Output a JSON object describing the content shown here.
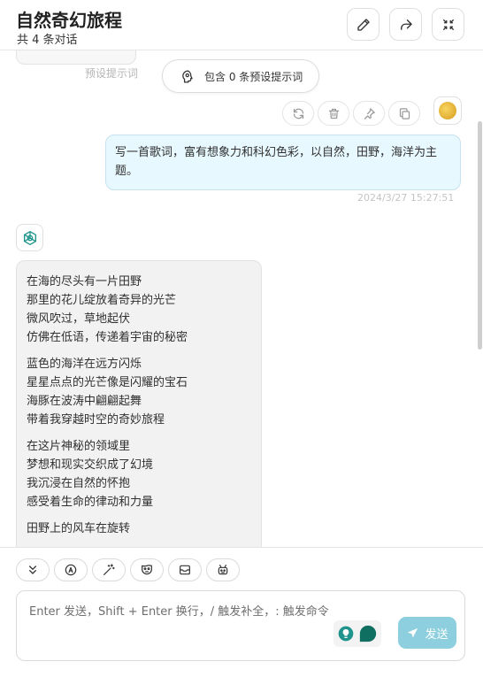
{
  "header": {
    "title": "自然奇幻旅程",
    "subtitle": "共 4 条对话",
    "buttons": [
      "edit-icon",
      "share-icon",
      "collapse-icon"
    ]
  },
  "chat": {
    "ghost_label": "预设提示词",
    "prompt_pill": "包含 0 条预设提示词",
    "message_actions": [
      "refresh-icon",
      "delete-icon",
      "pin-icon",
      "copy-icon"
    ],
    "user_message": {
      "text": "写一首歌词，富有想象力和科幻色彩，以自然，田野，海洋为主题。",
      "time": "2024/3/27 15:27:51"
    },
    "bot_message": {
      "stanzas": [
        [
          "在海的尽头有一片田野",
          "那里的花儿绽放着奇异的光芒",
          "微风吹过，草地起伏",
          "仿佛在低语，传递着宇宙的秘密"
        ],
        [
          "蓝色的海洋在远方闪烁",
          "星星点点的光芒像是闪耀的宝石",
          "海豚在波涛中翩翩起舞",
          "带着我穿越时空的奇妙旅程"
        ],
        [
          "在这片神秘的领域里",
          "梦想和现实交织成了幻境",
          "我沉浸在自然的怀抱",
          "感受着生命的律动和力量"
        ],
        [
          "田野上的风车在旋转"
        ]
      ]
    }
  },
  "input": {
    "toolbar": [
      "chevrons-down-icon",
      "model-icon",
      "magic-wand-icon",
      "mask-icon",
      "panel-icon",
      "robot-icon"
    ],
    "placeholder": "Enter 发送，Shift + Enter 换行，/ 触发补全，: 触发命令",
    "send_label": "发送",
    "colors": {
      "send": "#8dcfde",
      "user_bubble": "#e7f8ff",
      "accent": "#1f948c"
    }
  }
}
